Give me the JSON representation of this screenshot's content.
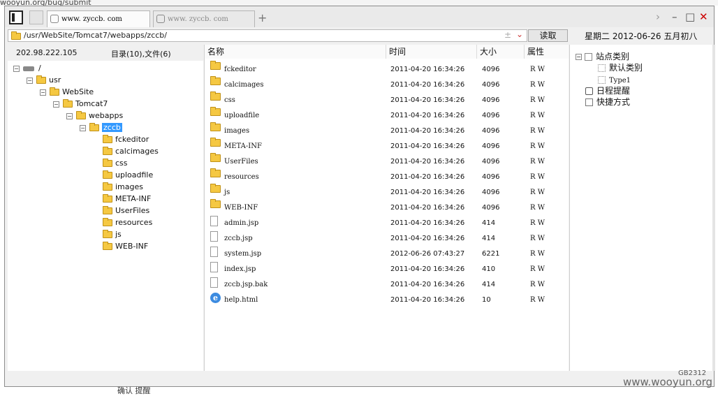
{
  "background_fragment": "wooyun.org/bug/submit",
  "tabs": [
    {
      "label": "www. zyccb. com",
      "active": true
    },
    {
      "label": "www. zyccb. com",
      "active": false
    }
  ],
  "address_path": "/usr/WebSite/Tomcat7/webapps/zccb/",
  "read_button": "读取",
  "date_text": "星期二 2012-06-26 五月初八",
  "server_ip": "202.98.222.105",
  "dir_summary": "目录(10),文件(6)",
  "tree": [
    {
      "label": "/",
      "depth": 0,
      "type": "drive",
      "exp": "-"
    },
    {
      "label": "usr",
      "depth": 1,
      "type": "folder",
      "exp": "-"
    },
    {
      "label": "WebSite",
      "depth": 2,
      "type": "folder",
      "exp": "-"
    },
    {
      "label": "Tomcat7",
      "depth": 3,
      "type": "folder",
      "exp": "-"
    },
    {
      "label": "webapps",
      "depth": 4,
      "type": "folder",
      "exp": "-"
    },
    {
      "label": "zccb",
      "depth": 5,
      "type": "folder",
      "exp": "-",
      "selected": true
    },
    {
      "label": "fckeditor",
      "depth": 6,
      "type": "folder"
    },
    {
      "label": "calcimages",
      "depth": 6,
      "type": "folder"
    },
    {
      "label": "css",
      "depth": 6,
      "type": "folder"
    },
    {
      "label": "uploadfile",
      "depth": 6,
      "type": "folder"
    },
    {
      "label": "images",
      "depth": 6,
      "type": "folder"
    },
    {
      "label": "META-INF",
      "depth": 6,
      "type": "folder"
    },
    {
      "label": "UserFiles",
      "depth": 6,
      "type": "folder"
    },
    {
      "label": "resources",
      "depth": 6,
      "type": "folder"
    },
    {
      "label": "js",
      "depth": 6,
      "type": "folder"
    },
    {
      "label": "WEB-INF",
      "depth": 6,
      "type": "folder"
    }
  ],
  "columns": {
    "name": "名称",
    "time": "时间",
    "size": "大小",
    "attr": "属性"
  },
  "files": [
    {
      "name": "fckeditor",
      "time": "2011-04-20 16:34:26",
      "size": "4096",
      "attr": "R W",
      "type": "folder"
    },
    {
      "name": "calcimages",
      "time": "2011-04-20 16:34:26",
      "size": "4096",
      "attr": "R W",
      "type": "folder"
    },
    {
      "name": "css",
      "time": "2011-04-20 16:34:26",
      "size": "4096",
      "attr": "R W",
      "type": "folder"
    },
    {
      "name": "uploadfile",
      "time": "2011-04-20 16:34:26",
      "size": "4096",
      "attr": "R W",
      "type": "folder"
    },
    {
      "name": "images",
      "time": "2011-04-20 16:34:26",
      "size": "4096",
      "attr": "R W",
      "type": "folder"
    },
    {
      "name": "META-INF",
      "time": "2011-04-20 16:34:26",
      "size": "4096",
      "attr": "R W",
      "type": "folder"
    },
    {
      "name": "UserFiles",
      "time": "2011-04-20 16:34:26",
      "size": "4096",
      "attr": "R W",
      "type": "folder"
    },
    {
      "name": "resources",
      "time": "2011-04-20 16:34:26",
      "size": "4096",
      "attr": "R W",
      "type": "folder"
    },
    {
      "name": "js",
      "time": "2011-04-20 16:34:26",
      "size": "4096",
      "attr": "R W",
      "type": "folder"
    },
    {
      "name": "WEB-INF",
      "time": "2011-04-20 16:34:26",
      "size": "4096",
      "attr": "R W",
      "type": "folder"
    },
    {
      "name": "admin.jsp",
      "time": "2011-04-20 16:34:26",
      "size": "414",
      "attr": "R W",
      "type": "file"
    },
    {
      "name": "zccb.jsp",
      "time": "2011-04-20 16:34:26",
      "size": "414",
      "attr": "R W",
      "type": "file"
    },
    {
      "name": "system.jsp",
      "time": "2012-06-26 07:43:27",
      "size": "6221",
      "attr": "R W",
      "type": "file"
    },
    {
      "name": "index.jsp",
      "time": "2011-04-20 16:34:26",
      "size": "410",
      "attr": "R W",
      "type": "file"
    },
    {
      "name": "zccb.jsp.bak",
      "time": "2011-04-20 16:34:26",
      "size": "414",
      "attr": "R W",
      "type": "file"
    },
    {
      "name": "help.html",
      "time": "2011-04-20 16:34:26",
      "size": "10",
      "attr": "R W",
      "type": "html"
    }
  ],
  "right_tree": [
    {
      "label": "站点类别",
      "depth": 0,
      "exp": "-",
      "icon": "minus-box"
    },
    {
      "label": "默认类别",
      "depth": 1,
      "icon": "box"
    },
    {
      "label": "Type1",
      "depth": 1,
      "icon": "box"
    },
    {
      "label": "日程提醒",
      "depth": 0,
      "icon": "clock"
    },
    {
      "label": "快捷方式",
      "depth": 0,
      "icon": "hand"
    }
  ],
  "encoding": "GB2312",
  "watermark": "www.wooyun.org",
  "bottom_fragment": "确认   提醒"
}
